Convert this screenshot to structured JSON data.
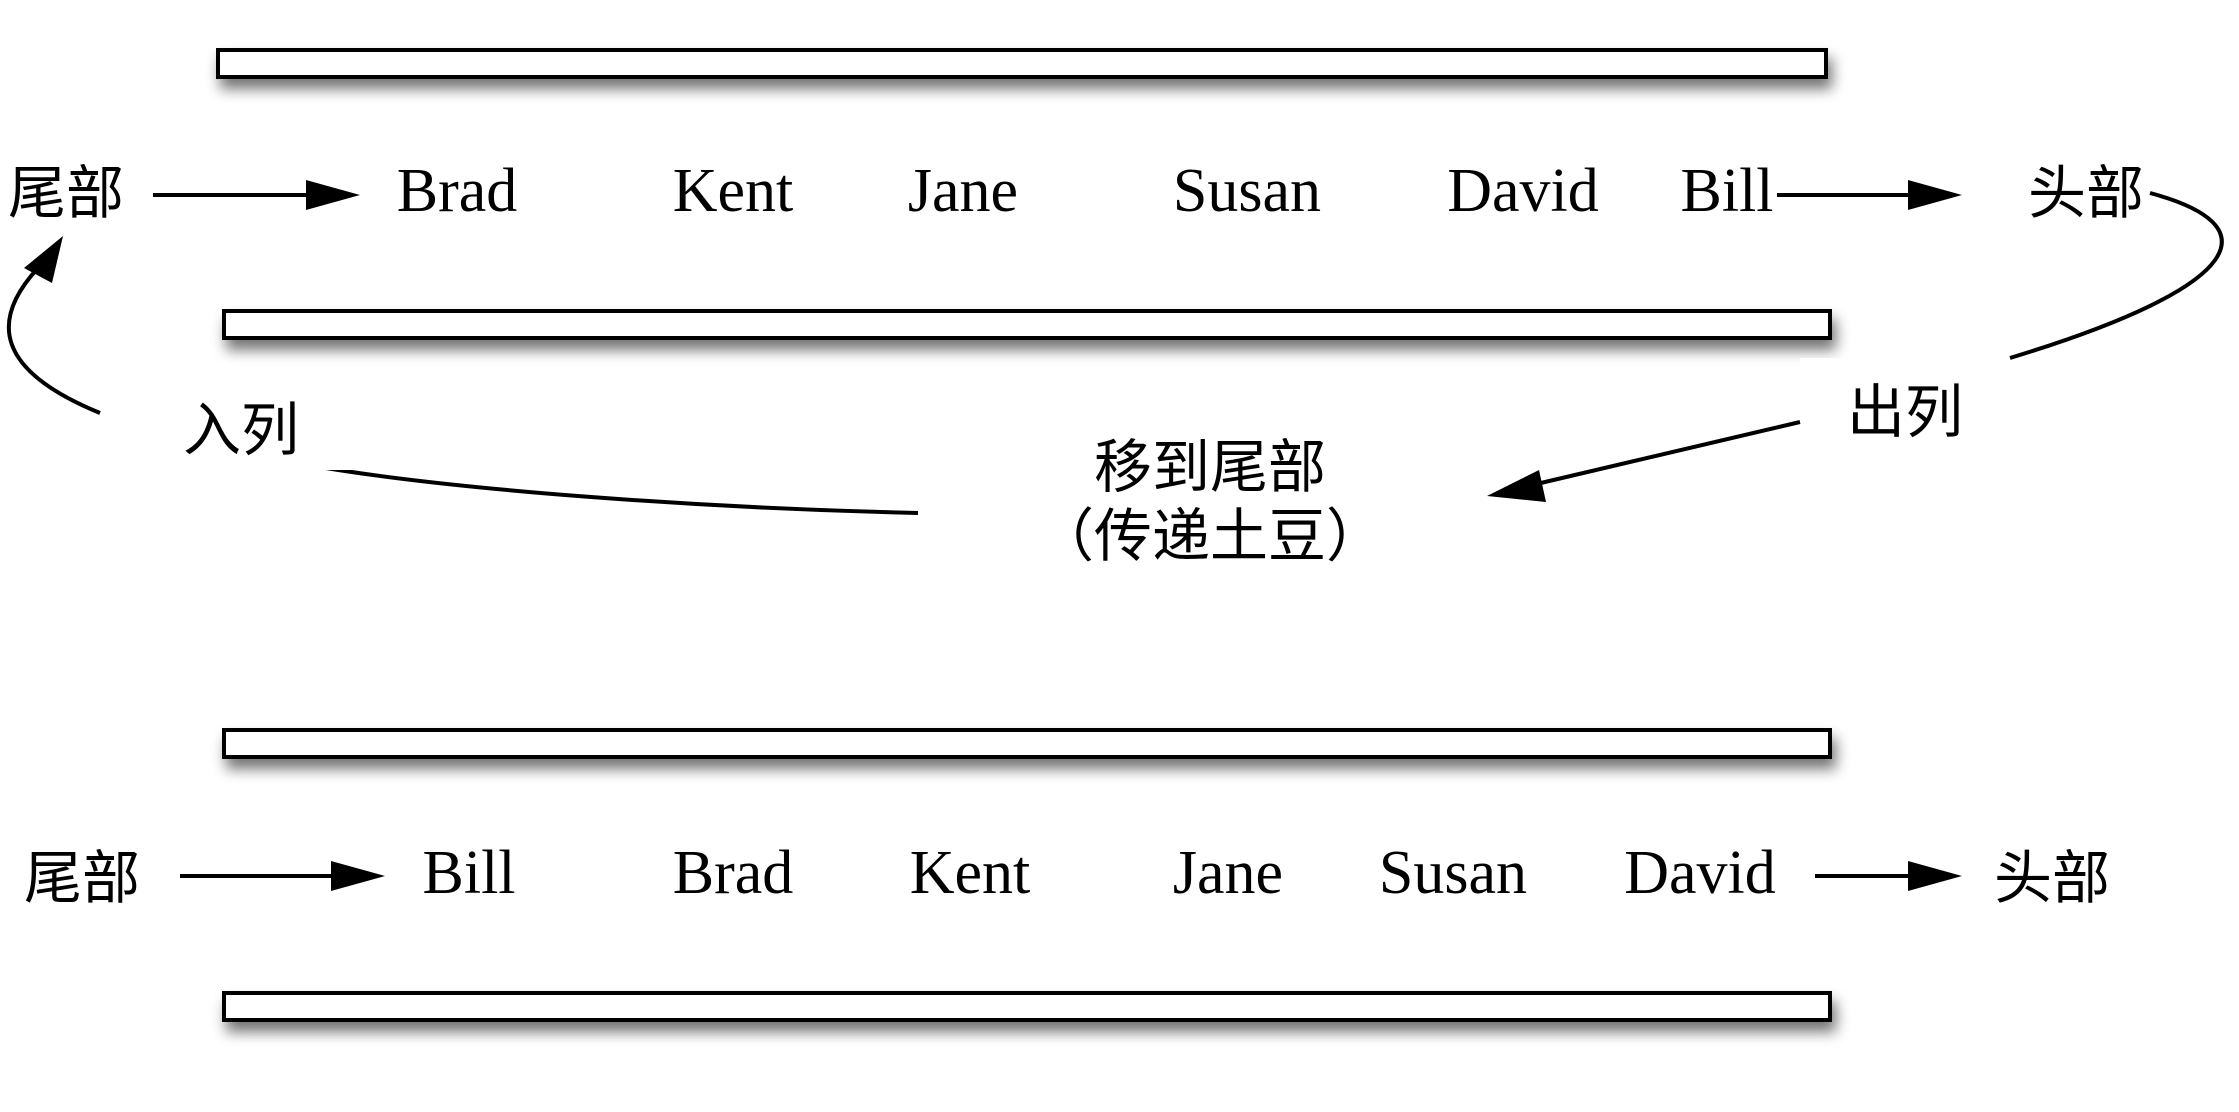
{
  "queue_before": {
    "tail_label": "尾部",
    "head_label": "头部",
    "items": [
      "Brad",
      "Kent",
      "Jane",
      "Susan",
      "David",
      "Bill"
    ]
  },
  "queue_after": {
    "tail_label": "尾部",
    "head_label": "头部",
    "items": [
      "Bill",
      "Brad",
      "Kent",
      "Jane",
      "Susan",
      "David"
    ]
  },
  "annotations": {
    "dequeue": "出列",
    "enqueue": "入列",
    "move_line1": "移到尾部",
    "move_line2": "（传递土豆）"
  },
  "colors": {
    "stroke": "#000000",
    "background": "#ffffff"
  }
}
